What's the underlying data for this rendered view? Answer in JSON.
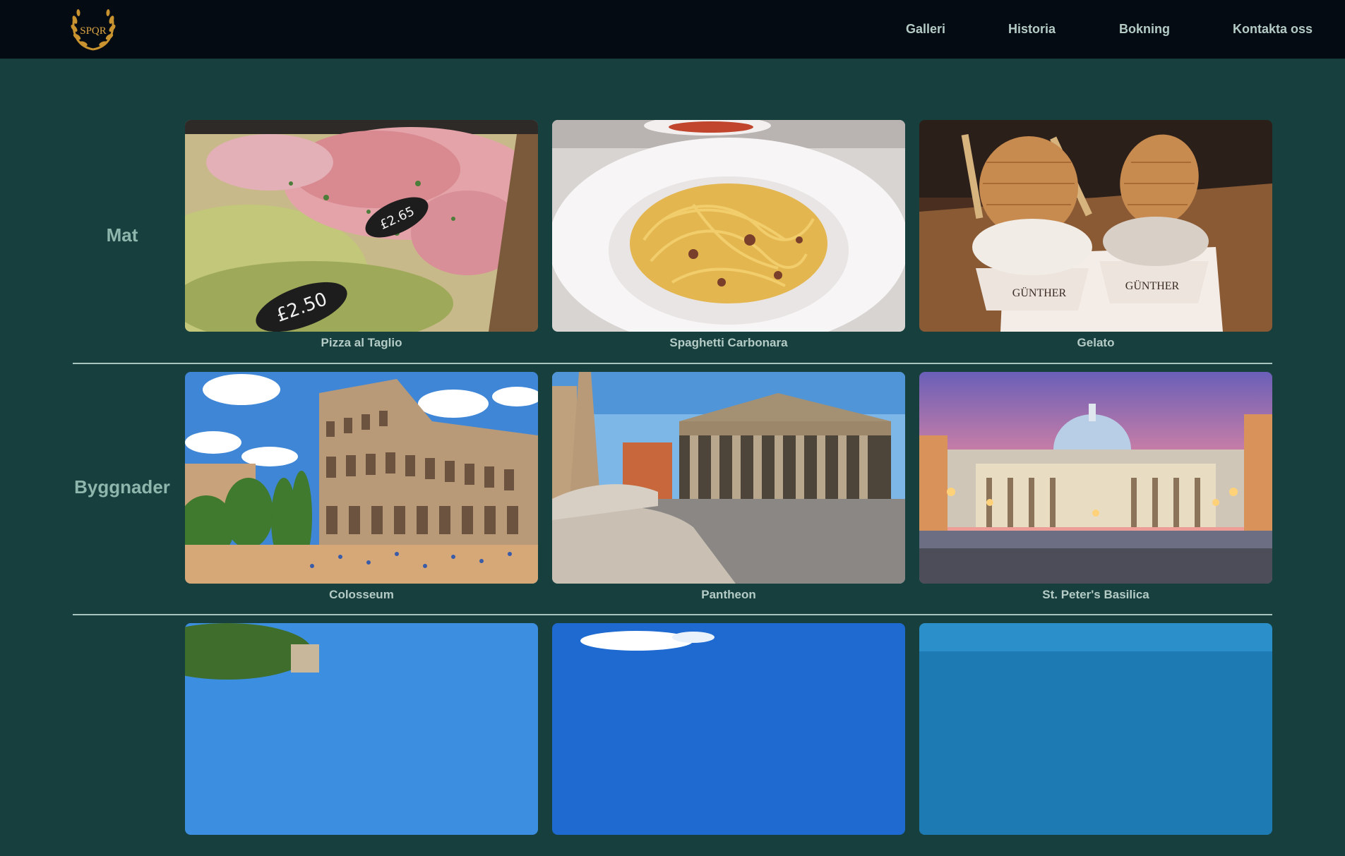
{
  "header": {
    "logo_text": "SPQR",
    "nav": [
      {
        "label": "Galleri"
      },
      {
        "label": "Historia"
      },
      {
        "label": "Bokning"
      },
      {
        "label": "Kontakta oss"
      }
    ]
  },
  "sections": [
    {
      "title": "Mat",
      "items": [
        {
          "caption": "Pizza al Taglio",
          "price_tags": [
            "£2.65",
            "£2.50"
          ]
        },
        {
          "caption": "Spaghetti Carbonara"
        },
        {
          "caption": "Gelato",
          "cup_text": "GÜNTHER"
        }
      ]
    },
    {
      "title": "Byggnader",
      "items": [
        {
          "caption": "Colosseum"
        },
        {
          "caption": "Pantheon"
        },
        {
          "caption": "St. Peter's Basilica"
        }
      ]
    },
    {
      "title": "",
      "items": [
        {
          "caption": ""
        },
        {
          "caption": ""
        },
        {
          "caption": ""
        }
      ]
    }
  ],
  "colors": {
    "header_bg": "#050b12",
    "page_bg": "#173f3d",
    "nav_text": "#b4cbc6",
    "section_title": "#8fb6ad",
    "divider": "#a9c5bf"
  }
}
